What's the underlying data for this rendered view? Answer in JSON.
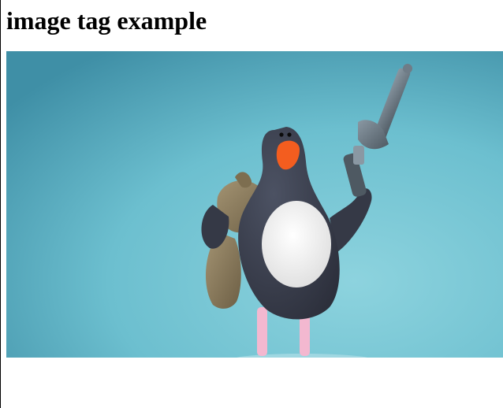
{
  "page": {
    "heading": "image tag example"
  },
  "image": {
    "subject": "clay-penguin-with-revolver",
    "colors": {
      "background": "#6fc2d2",
      "body": "#3a3e4c",
      "belly": "#efefef",
      "beak": "#f35d1f",
      "legs": "#f3b8d0",
      "sack": "#8c7a5b",
      "gun": "#66737e"
    }
  }
}
